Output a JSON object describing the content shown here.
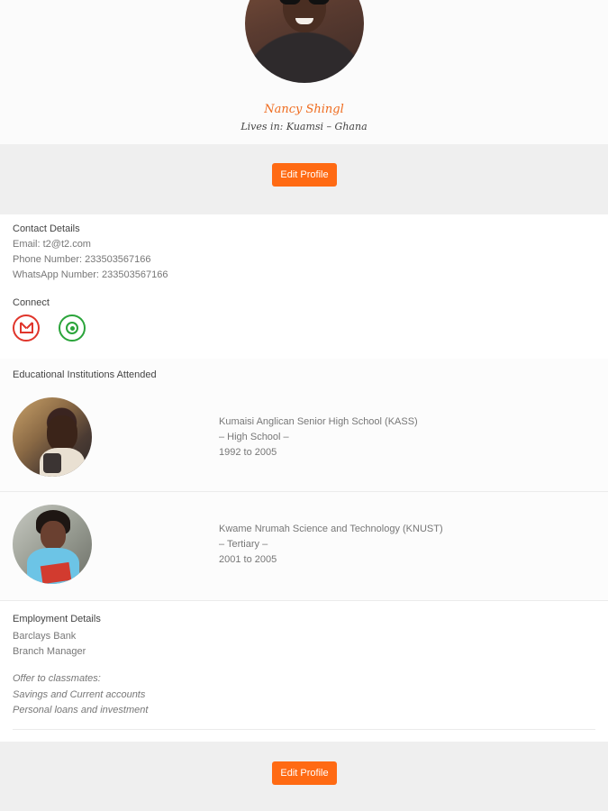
{
  "profile": {
    "name": "Nancy Shingl",
    "lives_in": "Lives in: Kuamsi – Ghana"
  },
  "actions": {
    "edit_profile_label": "Edit Profile"
  },
  "contact": {
    "heading": "Contact Details",
    "email": "Email: t2@t2.com",
    "phone": "Phone Number: 233503567166",
    "whatsapp": "WhatsApp Number: 233503567166"
  },
  "connect": {
    "heading": "Connect",
    "icons": [
      "gmail-icon",
      "whatsapp-icon"
    ],
    "colors": {
      "gmail": "#e0352b",
      "whatsapp": "#2aa43a"
    }
  },
  "education": {
    "heading": "Educational Institutions Attended",
    "items": [
      {
        "name": "Kumaisi Anglican Senior High School (KASS)",
        "level": "– High School –",
        "years": "1992 to 2005"
      },
      {
        "name": "Kwame Nrumah Science and Technology (KNUST)",
        "level": "– Tertiary –",
        "years": "2001 to 2005"
      }
    ]
  },
  "employment": {
    "heading": "Employment Details",
    "company": "Barclays Bank",
    "role": "Branch Manager",
    "offer_label": "Offer to classmates:",
    "offer_line1": "Savings and Current accounts",
    "offer_line2": "Personal loans and investment"
  },
  "theme": {
    "accent": "#ff6a13",
    "name_color": "#ef6c1f",
    "band_bg": "#efefef"
  }
}
